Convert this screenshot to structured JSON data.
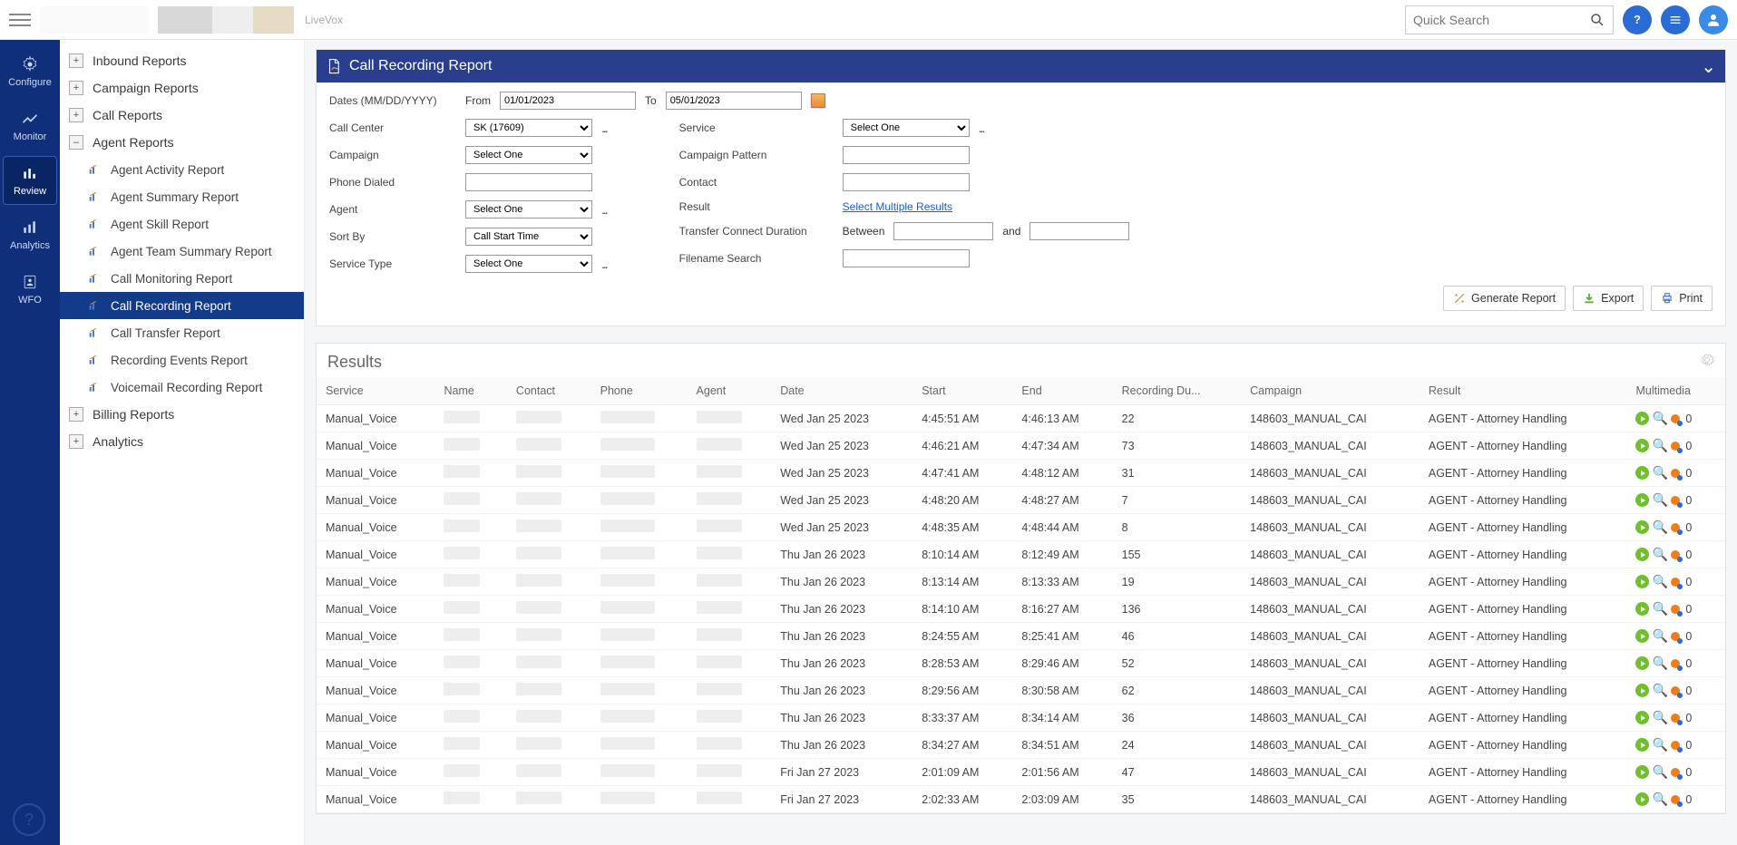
{
  "top": {
    "brand": "LiveVox",
    "search_placeholder": "Quick Search"
  },
  "leftnav": [
    {
      "id": "configure",
      "label": "Configure"
    },
    {
      "id": "monitor",
      "label": "Monitor"
    },
    {
      "id": "review",
      "label": "Review",
      "active": true
    },
    {
      "id": "analytics",
      "label": "Analytics"
    },
    {
      "id": "wfo",
      "label": "WFO"
    }
  ],
  "tree": {
    "inbound": "Inbound Reports",
    "campaign": "Campaign Reports",
    "call": "Call Reports",
    "agent": "Agent Reports",
    "agent_children": [
      "Agent Activity Report",
      "Agent Summary Report",
      "Agent Skill Report",
      "Agent Team Summary Report",
      "Call Monitoring Report",
      "Call Recording Report",
      "Call Transfer Report",
      "Recording Events Report",
      "Voicemail Recording Report"
    ],
    "agent_active_index": 5,
    "billing": "Billing Reports",
    "analytics": "Analytics"
  },
  "panel": {
    "title": "Call Recording Report",
    "filters": {
      "dates_label": "Dates (MM/DD/YYYY)",
      "from_label": "From",
      "from_value": "01/01/2023",
      "to_label": "To",
      "to_value": "05/01/2023",
      "call_center_label": "Call Center",
      "call_center_value": "SK (17609)",
      "campaign_label": "Campaign",
      "campaign_value": "Select One",
      "phone_dialed_label": "Phone Dialed",
      "agent_label": "Agent",
      "agent_value": "Select One",
      "sort_by_label": "Sort By",
      "sort_by_value": "Call Start Time",
      "service_type_label": "Service Type",
      "service_type_value": "Select One",
      "service_label": "Service",
      "service_value": "Select One",
      "campaign_pattern_label": "Campaign Pattern",
      "contact_label": "Contact",
      "result_label": "Result",
      "result_link": "Select Multiple Results",
      "tcd_label": "Transfer Connect Duration",
      "between_label": "Between",
      "and_label": "and",
      "filename_label": "Filename Search"
    },
    "actions": {
      "generate": "Generate Report",
      "export": "Export",
      "print": "Print"
    }
  },
  "results": {
    "title": "Results",
    "columns": [
      "Service",
      "Name",
      "Contact",
      "Phone",
      "Agent",
      "Date",
      "Start",
      "End",
      "Recording Du...",
      "Campaign",
      "Result",
      "Multimedia"
    ],
    "rows": [
      {
        "service": "Manual_Voice",
        "date": "Wed Jan 25 2023",
        "start": "4:45:51 AM",
        "end": "4:46:13 AM",
        "dur": "22",
        "campaign": "148603_MANUAL_CAI",
        "result": "AGENT - Attorney Handling",
        "mm": "0"
      },
      {
        "service": "Manual_Voice",
        "date": "Wed Jan 25 2023",
        "start": "4:46:21 AM",
        "end": "4:47:34 AM",
        "dur": "73",
        "campaign": "148603_MANUAL_CAI",
        "result": "AGENT - Attorney Handling",
        "mm": "0"
      },
      {
        "service": "Manual_Voice",
        "date": "Wed Jan 25 2023",
        "start": "4:47:41 AM",
        "end": "4:48:12 AM",
        "dur": "31",
        "campaign": "148603_MANUAL_CAI",
        "result": "AGENT - Attorney Handling",
        "mm": "0"
      },
      {
        "service": "Manual_Voice",
        "date": "Wed Jan 25 2023",
        "start": "4:48:20 AM",
        "end": "4:48:27 AM",
        "dur": "7",
        "campaign": "148603_MANUAL_CAI",
        "result": "AGENT - Attorney Handling",
        "mm": "0"
      },
      {
        "service": "Manual_Voice",
        "date": "Wed Jan 25 2023",
        "start": "4:48:35 AM",
        "end": "4:48:44 AM",
        "dur": "8",
        "campaign": "148603_MANUAL_CAI",
        "result": "AGENT - Attorney Handling",
        "mm": "0"
      },
      {
        "service": "Manual_Voice",
        "date": "Thu Jan 26 2023",
        "start": "8:10:14 AM",
        "end": "8:12:49 AM",
        "dur": "155",
        "campaign": "148603_MANUAL_CAI",
        "result": "AGENT - Attorney Handling",
        "mm": "0"
      },
      {
        "service": "Manual_Voice",
        "date": "Thu Jan 26 2023",
        "start": "8:13:14 AM",
        "end": "8:13:33 AM",
        "dur": "19",
        "campaign": "148603_MANUAL_CAI",
        "result": "AGENT - Attorney Handling",
        "mm": "0"
      },
      {
        "service": "Manual_Voice",
        "date": "Thu Jan 26 2023",
        "start": "8:14:10 AM",
        "end": "8:16:27 AM",
        "dur": "136",
        "campaign": "148603_MANUAL_CAI",
        "result": "AGENT - Attorney Handling",
        "mm": "0"
      },
      {
        "service": "Manual_Voice",
        "date": "Thu Jan 26 2023",
        "start": "8:24:55 AM",
        "end": "8:25:41 AM",
        "dur": "46",
        "campaign": "148603_MANUAL_CAI",
        "result": "AGENT - Attorney Handling",
        "mm": "0"
      },
      {
        "service": "Manual_Voice",
        "date": "Thu Jan 26 2023",
        "start": "8:28:53 AM",
        "end": "8:29:46 AM",
        "dur": "52",
        "campaign": "148603_MANUAL_CAI",
        "result": "AGENT - Attorney Handling",
        "mm": "0"
      },
      {
        "service": "Manual_Voice",
        "date": "Thu Jan 26 2023",
        "start": "8:29:56 AM",
        "end": "8:30:58 AM",
        "dur": "62",
        "campaign": "148603_MANUAL_CAI",
        "result": "AGENT - Attorney Handling",
        "mm": "0"
      },
      {
        "service": "Manual_Voice",
        "date": "Thu Jan 26 2023",
        "start": "8:33:37 AM",
        "end": "8:34:14 AM",
        "dur": "36",
        "campaign": "148603_MANUAL_CAI",
        "result": "AGENT - Attorney Handling",
        "mm": "0"
      },
      {
        "service": "Manual_Voice",
        "date": "Thu Jan 26 2023",
        "start": "8:34:27 AM",
        "end": "8:34:51 AM",
        "dur": "24",
        "campaign": "148603_MANUAL_CAI",
        "result": "AGENT - Attorney Handling",
        "mm": "0"
      },
      {
        "service": "Manual_Voice",
        "date": "Fri Jan 27 2023",
        "start": "2:01:09 AM",
        "end": "2:01:56 AM",
        "dur": "47",
        "campaign": "148603_MANUAL_CAI",
        "result": "AGENT - Attorney Handling",
        "mm": "0"
      },
      {
        "service": "Manual_Voice",
        "date": "Fri Jan 27 2023",
        "start": "2:02:33 AM",
        "end": "2:03:09 AM",
        "dur": "35",
        "campaign": "148603_MANUAL_CAI",
        "result": "AGENT - Attorney Handling",
        "mm": "0"
      }
    ]
  }
}
